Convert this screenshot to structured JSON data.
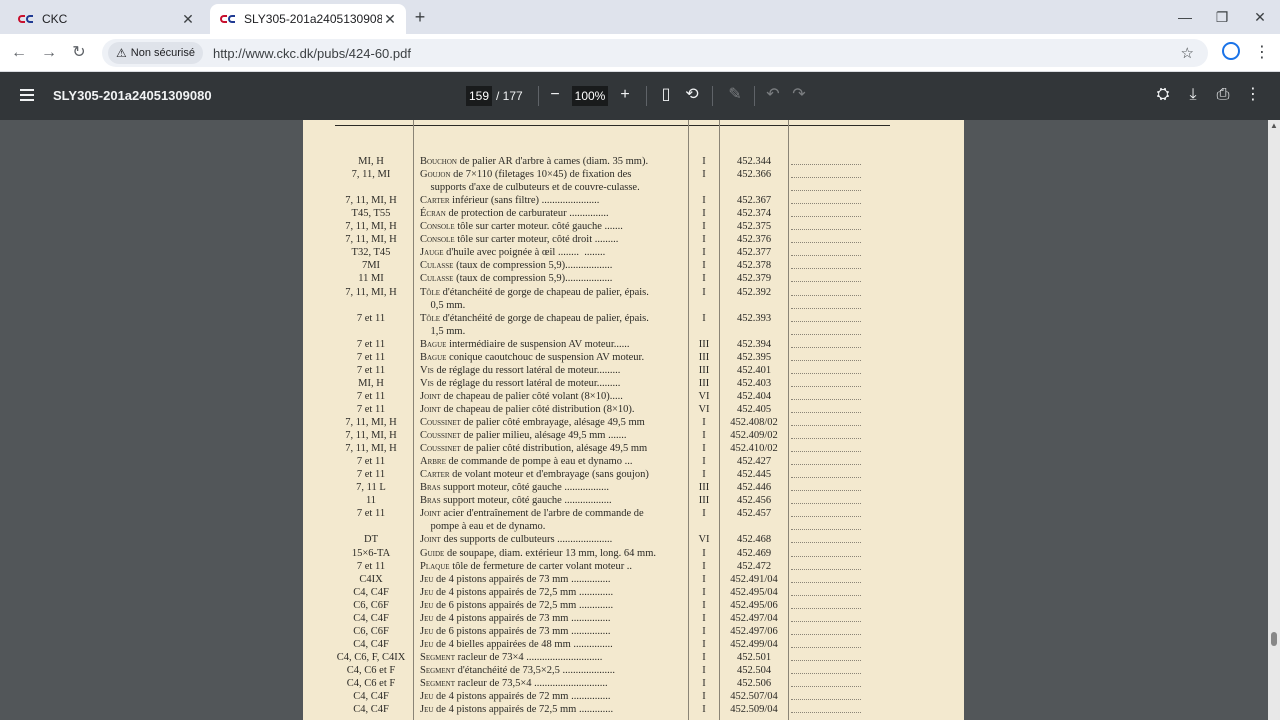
{
  "browser": {
    "tabs": [
      {
        "title": "CKC",
        "active": false
      },
      {
        "title": "SLY305-201a24051309080",
        "active": true
      }
    ],
    "security_label": "Non sécurisé",
    "url": "http://www.ckc.dk/pubs/424-60.pdf"
  },
  "pdf": {
    "title": "SLY305-201a24051309080",
    "current_page": "159",
    "total_pages": "/ 177",
    "zoom": "100%"
  },
  "rows": [
    {
      "c1": "MI, H",
      "w": "Bouchon",
      "d": " de palier AR d'arbre à cames (diam. 35 mm).",
      "c3": "I",
      "c4": "452.344"
    },
    {
      "c1": "7, 11, MI",
      "w": "Goujon",
      "d": " de 7×110 (filetages 10×45) de fixation des",
      "c3": "I",
      "c4": "452.366"
    },
    {
      "c1": "",
      "w": "",
      "d": "    supports d'axe de culbuteurs et de couvre-culasse.",
      "c3": "",
      "c4": ""
    },
    {
      "c1": "7, 11, MI, H",
      "w": "Carter",
      "d": " inférieur (sans filtre) ......................",
      "c3": "I",
      "c4": "452.367"
    },
    {
      "c1": "T45, T55",
      "w": "Écran",
      "d": " de protection de carburateur ...............",
      "c3": "I",
      "c4": "452.374"
    },
    {
      "c1": "7, 11, MI, H",
      "w": "Console",
      "d": " tôle sur carter moteur. côté gauche .......",
      "c3": "I",
      "c4": "452.375"
    },
    {
      "c1": "7, 11, MI, H",
      "w": "Console",
      "d": " tôle sur carter moteur, côté droit .........",
      "c3": "I",
      "c4": "452.376"
    },
    {
      "c1": "T32, T45",
      "w": "Jauge",
      "d": " d'huile avec poignée à œil ........  ........",
      "c3": "I",
      "c4": "452.377"
    },
    {
      "c1": "7MI",
      "w": "Culasse",
      "d": " (taux de compression 5,9)..................",
      "c3": "I",
      "c4": "452.378"
    },
    {
      "c1": "11 MI",
      "w": "Culasse",
      "d": " (taux de compression 5,9)..................",
      "c3": "I",
      "c4": "452.379"
    },
    {
      "c1": "7, 11, MI, H",
      "w": "Tôle",
      "d": " d'étanchéité de gorge de chapeau de palier, épais.",
      "c3": "I",
      "c4": "452.392"
    },
    {
      "c1": "",
      "w": "",
      "d": "    0,5 mm.",
      "c3": "",
      "c4": ""
    },
    {
      "c1": "7 et 11",
      "w": "Tôle",
      "d": " d'étanchéité de gorge de chapeau de palier, épais.",
      "c3": "I",
      "c4": "452.393"
    },
    {
      "c1": "",
      "w": "",
      "d": "    1,5 mm.",
      "c3": "",
      "c4": ""
    },
    {
      "c1": "7 et 11",
      "w": "Bague",
      "d": " intermédiaire de suspension AV moteur......",
      "c3": "III",
      "c4": "452.394"
    },
    {
      "c1": "7 et 11",
      "w": "Bague",
      "d": " conique caoutchouc de suspension AV moteur.",
      "c3": "III",
      "c4": "452.395"
    },
    {
      "c1": "7 et 11",
      "w": "Vis",
      "d": " de réglage du ressort latéral de moteur.........",
      "c3": "III",
      "c4": "452.401"
    },
    {
      "c1": "MI, H",
      "w": "Vis",
      "d": " de réglage du ressort latéral de moteur.........",
      "c3": "III",
      "c4": "452.403"
    },
    {
      "c1": "7 et 11",
      "w": "Joint",
      "d": " de chapeau de palier côté volant (8×10).....",
      "c3": "VI",
      "c4": "452.404"
    },
    {
      "c1": "7 et 11",
      "w": "Joint",
      "d": " de chapeau de palier côté distribution (8×10).",
      "c3": "VI",
      "c4": "452.405"
    },
    {
      "c1": "7, 11, MI, H",
      "w": "Coussinet",
      "d": " de palier côté embrayage, alésage 49,5 mm",
      "c3": "I",
      "c4": "452.408/02"
    },
    {
      "c1": "7, 11, MI, H",
      "w": "Coussinet",
      "d": " de palier milieu, alésage 49,5 mm .......",
      "c3": "I",
      "c4": "452.409/02"
    },
    {
      "c1": "7, 11, MI, H",
      "w": "Coussinet",
      "d": " de palier côté distribution, alésage 49,5 mm",
      "c3": "I",
      "c4": "452.410/02"
    },
    {
      "c1": "7 et 11",
      "w": "Arbre",
      "d": " de commande de pompe à eau et dynamo ...",
      "c3": "I",
      "c4": "452.427"
    },
    {
      "c1": "7 et 11",
      "w": "Carter",
      "d": " de volant moteur et d'embrayage (sans goujon)",
      "c3": "I",
      "c4": "452.445"
    },
    {
      "c1": "7, 11 L",
      "w": "Bras",
      "d": " support moteur, côté gauche .................",
      "c3": "III",
      "c4": "452.446"
    },
    {
      "c1": "11",
      "w": "Bras",
      "d": " support moteur, côté gauche ..................",
      "c3": "III",
      "c4": "452.456"
    },
    {
      "c1": "7 et 11",
      "w": "Joint",
      "d": " acier d'entraînement de l'arbre de commande de",
      "c3": "I",
      "c4": "452.457"
    },
    {
      "c1": "",
      "w": "",
      "d": "    pompe à eau et de dynamo.",
      "c3": "",
      "c4": ""
    },
    {
      "c1": "DT",
      "w": "Joint",
      "d": " des supports de culbuteurs .....................",
      "c3": "VI",
      "c4": "452.468"
    },
    {
      "c1": "15×6-TA",
      "w": "Guide",
      "d": " de soupape, diam. extérieur 13 mm, long. 64 mm.",
      "c3": "I",
      "c4": "452.469"
    },
    {
      "c1": "7 et 11",
      "w": "Plaque",
      "d": " tôle de fermeture de carter volant moteur ..",
      "c3": "I",
      "c4": "452.472"
    },
    {
      "c1": "C4IX",
      "w": "Jeu",
      "d": " de 4 pistons appairés de 73 mm ...............",
      "c3": "I",
      "c4": "452.491/04"
    },
    {
      "c1": "C4, C4F",
      "w": "Jeu",
      "d": " de 4 pistons appairés de 72,5 mm .............",
      "c3": "I",
      "c4": "452.495/04"
    },
    {
      "c1": "C6, C6F",
      "w": "Jeu",
      "d": " de 6 pistons appairés de 72,5 mm .............",
      "c3": "I",
      "c4": "452.495/06"
    },
    {
      "c1": "C4, C4F",
      "w": "Jeu",
      "d": " de 4 pistons appairés de 73 mm ...............",
      "c3": "I",
      "c4": "452.497/04"
    },
    {
      "c1": "C6, C6F",
      "w": "Jeu",
      "d": " de 6 pistons appairés de 73 mm ...............",
      "c3": "I",
      "c4": "452.497/06"
    },
    {
      "c1": "C4, C4F",
      "w": "Jeu",
      "d": " de 4 bielles appairées de 48 mm ...............",
      "c3": "I",
      "c4": "452.499/04"
    },
    {
      "c1": "C4, C6, F, C4IX",
      "w": "Segment",
      "d": " racleur de 73×4 .............................",
      "c3": "I",
      "c4": "452.501"
    },
    {
      "c1": "C4, C6 et F",
      "w": "Segment",
      "d": " d'étanchéité de 73,5×2,5 ....................",
      "c3": "I",
      "c4": "452.504"
    },
    {
      "c1": "C4, C6 et F",
      "w": "Segment",
      "d": " racleur de 73,5×4 ............................",
      "c3": "I",
      "c4": "452.506"
    },
    {
      "c1": "C4, C4F",
      "w": "Jeu",
      "d": " de 4 pistons appairés de 72 mm ...............",
      "c3": "I",
      "c4": "452.507/04"
    },
    {
      "c1": "C4, C4F",
      "w": "Jeu",
      "d": " de 4 pistons appairés de 72,5 mm .............",
      "c3": "I",
      "c4": "452.509/04"
    }
  ]
}
